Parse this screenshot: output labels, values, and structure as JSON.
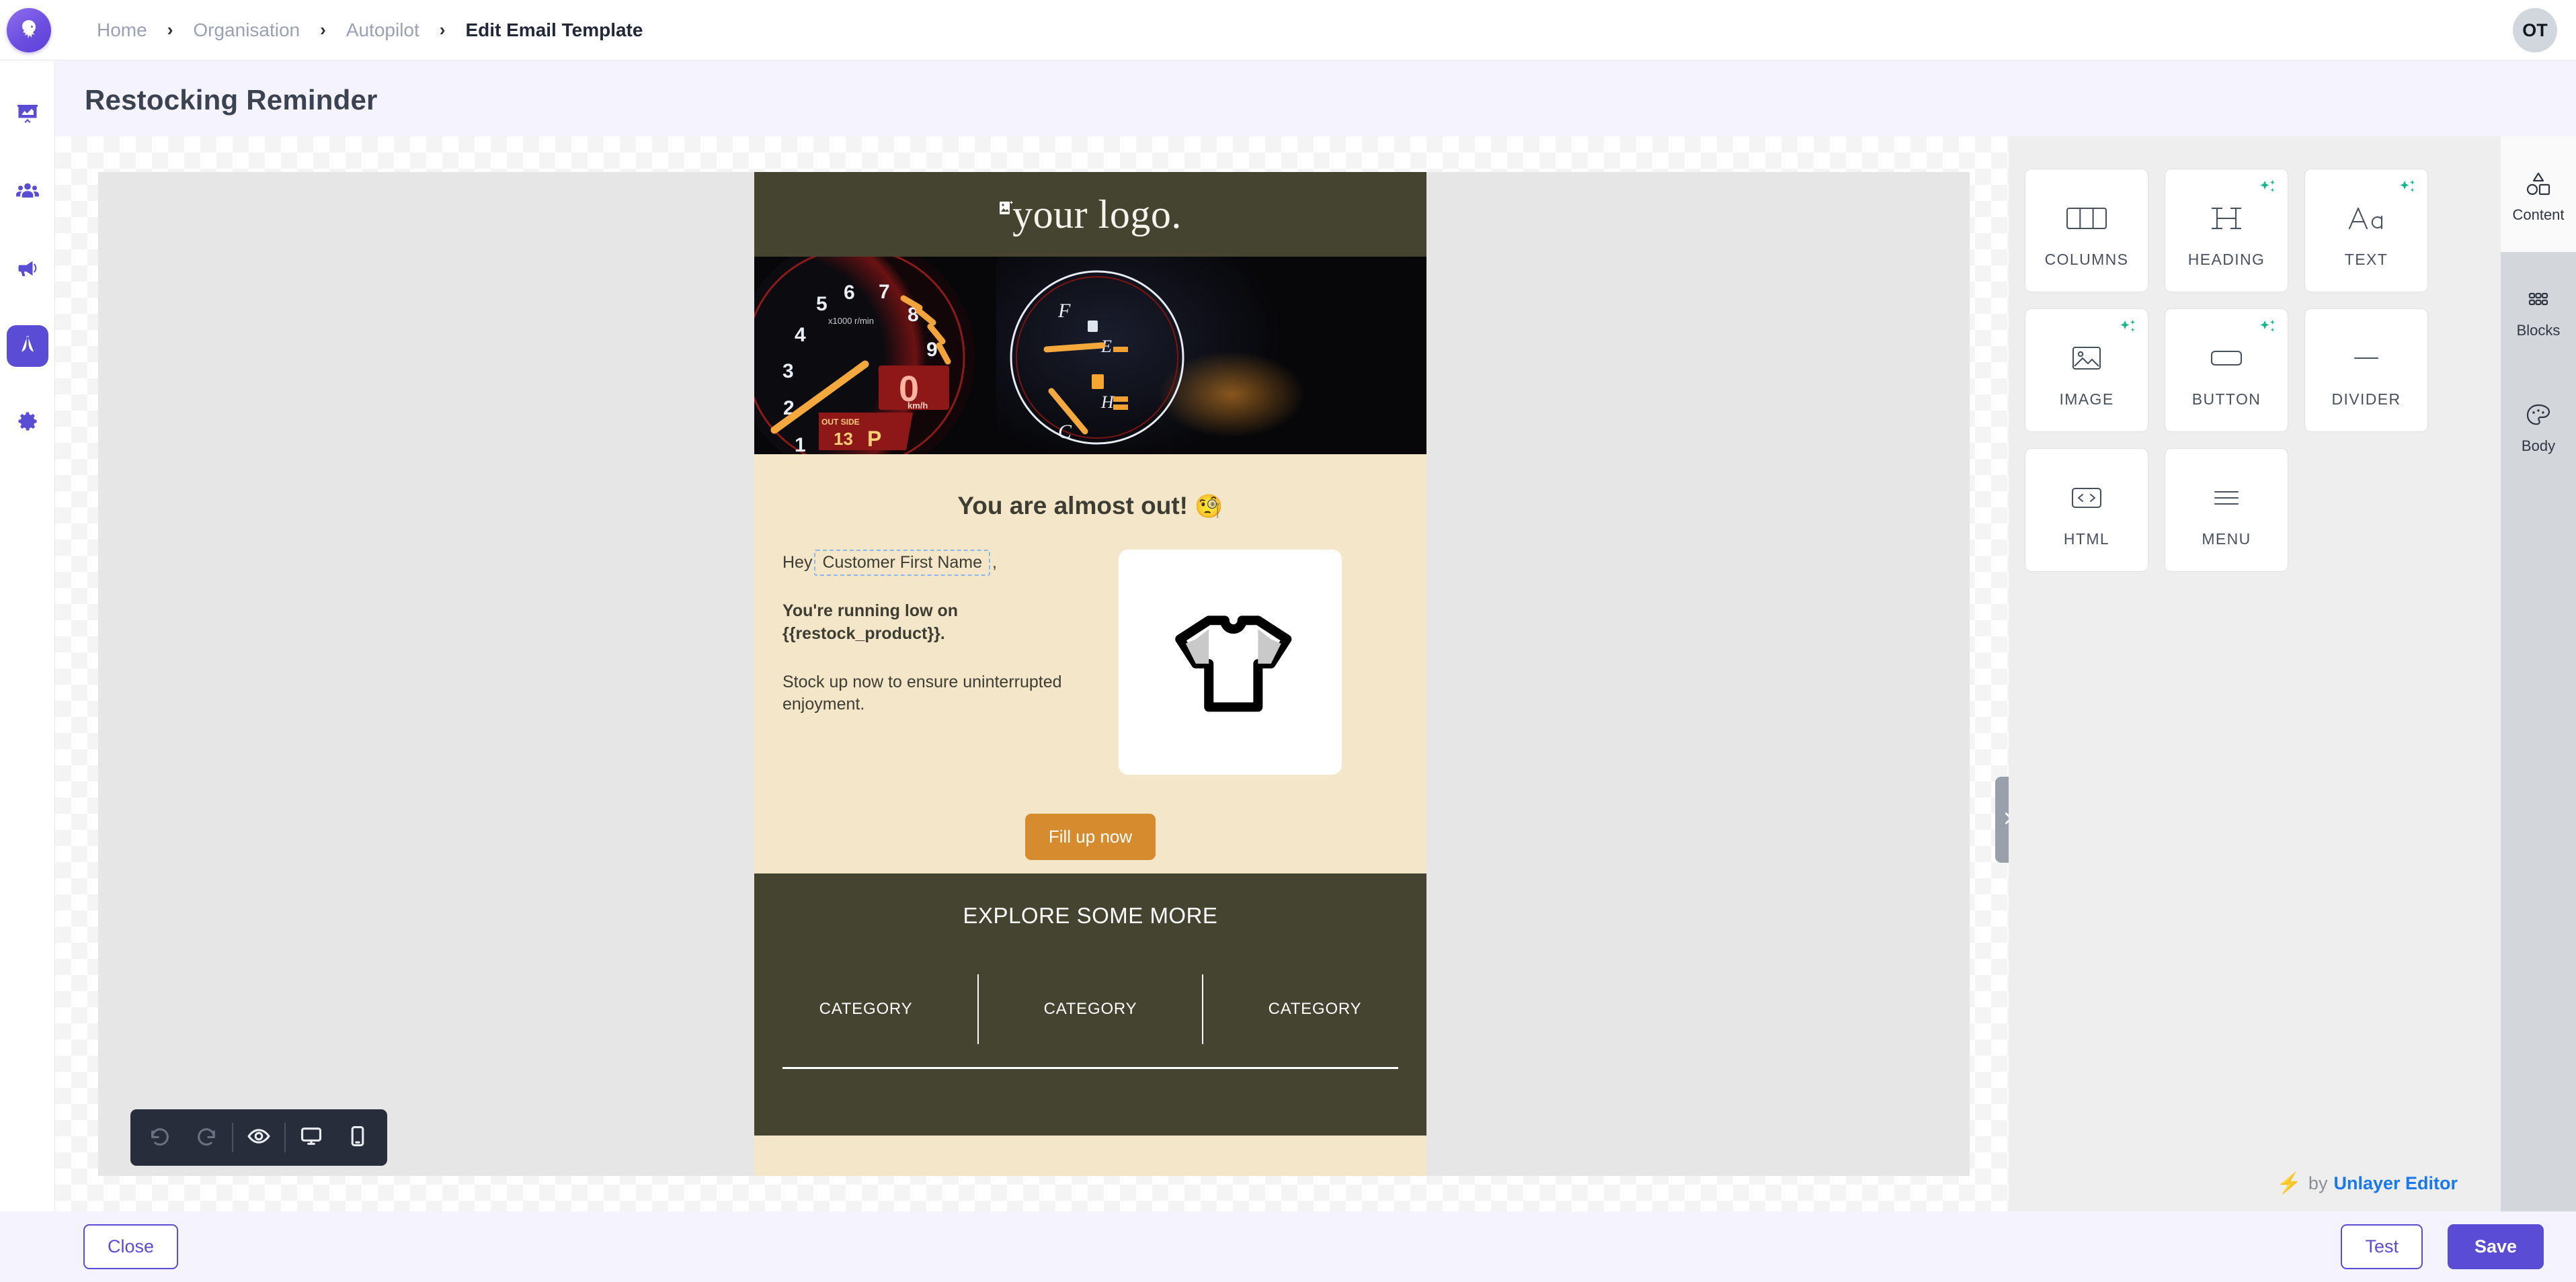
{
  "topbar": {
    "logo_icon": "eagle-logo-icon",
    "breadcrumbs": [
      {
        "label": "Home"
      },
      {
        "label": "Organisation"
      },
      {
        "label": "Autopilot"
      },
      {
        "label": "Edit Email Template"
      }
    ],
    "separator": "›",
    "avatar_initials": "OT"
  },
  "sidebar": {
    "items": [
      {
        "name": "analytics",
        "icon": "presentation-chart-icon"
      },
      {
        "name": "audience",
        "icon": "users-icon"
      },
      {
        "name": "campaigns",
        "icon": "megaphone-icon"
      },
      {
        "name": "autopilot",
        "icon": "autopilot-icon",
        "active": true
      },
      {
        "name": "settings",
        "icon": "gear-icon"
      }
    ]
  },
  "page": {
    "title": "Restocking Reminder"
  },
  "email": {
    "logo_text": "your logo.",
    "logo_icon": "image-placeholder-icon",
    "hero_alt": "car-dashboard-gauges-photo",
    "headline": "You are almost out!",
    "headline_emoji": "🧐",
    "greeting_prefix": "Hey",
    "merge_tag": "Customer First Name",
    "greeting_suffix": ",",
    "paragraph_bold": "You're running low on {{restock_product}}.",
    "paragraph": "Stock up now to ensure uninterrupted enjoyment.",
    "product_icon": "tshirt-icon",
    "cta_label": "Fill up now",
    "cta_color": "#d68c2e",
    "footer_title": "EXPLORE SOME MORE",
    "footer_categories": [
      "CATEGORY",
      "CATEGORY",
      "CATEGORY"
    ],
    "header_color": "#444431",
    "body_color": "#f4e6c8"
  },
  "mini_toolbar": {
    "buttons": [
      {
        "name": "undo",
        "icon": "undo-icon",
        "disabled": true
      },
      {
        "name": "redo",
        "icon": "redo-icon",
        "disabled": true
      },
      {
        "name": "preview",
        "icon": "eye-icon",
        "disabled": false
      },
      {
        "name": "desktop",
        "icon": "desktop-icon",
        "disabled": false
      },
      {
        "name": "mobile",
        "icon": "mobile-icon",
        "disabled": false
      }
    ]
  },
  "panel": {
    "collapse_icon": "chevron-right-icon",
    "tiles": [
      {
        "label": "COLUMNS",
        "icon": "columns-icon",
        "ai": false
      },
      {
        "label": "HEADING",
        "icon": "heading-icon",
        "ai": true
      },
      {
        "label": "TEXT",
        "icon": "text-aa-icon",
        "ai": true
      },
      {
        "label": "IMAGE",
        "icon": "image-icon",
        "ai": true
      },
      {
        "label": "BUTTON",
        "icon": "button-icon",
        "ai": true
      },
      {
        "label": "DIVIDER",
        "icon": "divider-icon",
        "ai": false
      },
      {
        "label": "HTML",
        "icon": "code-icon",
        "ai": false
      },
      {
        "label": "MENU",
        "icon": "menu-icon",
        "ai": false
      }
    ],
    "tabs": [
      {
        "label": "Content",
        "icon": "shapes-icon",
        "active": true
      },
      {
        "label": "Blocks",
        "icon": "grid-dots-icon",
        "active": false
      },
      {
        "label": "Body",
        "icon": "palette-icon",
        "active": false
      }
    ],
    "ai_badge_color": "#14b98a",
    "credit_bolt": "⚡",
    "credit_by": "by",
    "credit_name": "Unlayer Editor"
  },
  "actions": {
    "close_label": "Close",
    "test_label": "Test",
    "save_label": "Save",
    "accent_color": "#5b4cd6"
  }
}
